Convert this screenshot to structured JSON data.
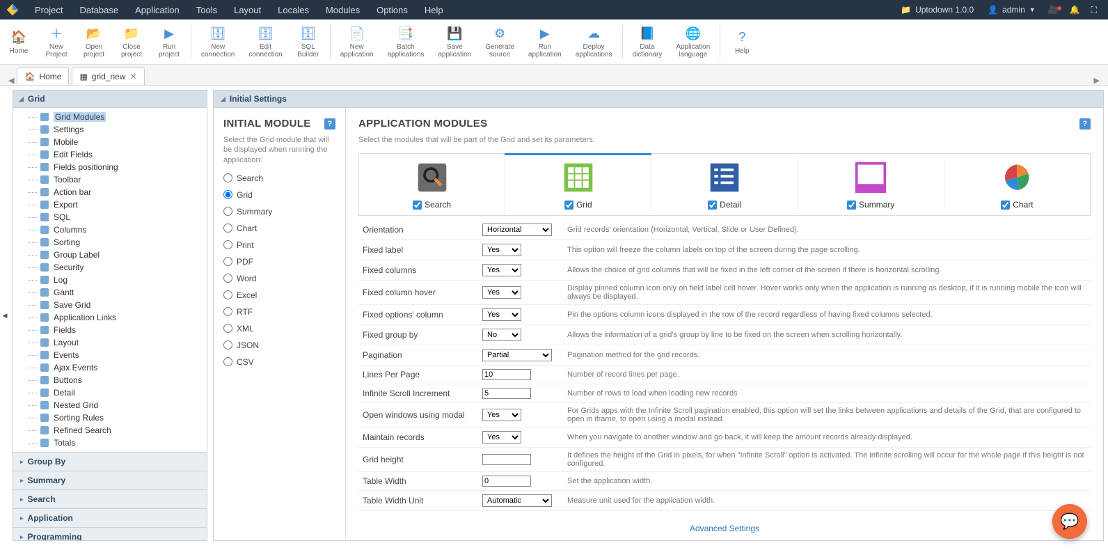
{
  "menubar": {
    "items": [
      "Project",
      "Database",
      "Application",
      "Tools",
      "Layout",
      "Locales",
      "Modules",
      "Options",
      "Help"
    ],
    "project_label": "Uptodown 1.0.0",
    "user_label": "admin"
  },
  "toolbar": {
    "groups": [
      [
        {
          "icon": "🏠",
          "label": "Home"
        },
        {
          "icon": "＋",
          "label": "New\nProject"
        },
        {
          "icon": "📂",
          "label": "Open\nproject"
        },
        {
          "icon": "📁",
          "label": "Close\nproject"
        },
        {
          "icon": "▶",
          "label": "Run\nproject"
        }
      ],
      [
        {
          "icon": "🗄",
          "label": "New\nconnection"
        },
        {
          "icon": "🗄",
          "label": "Edit\nconnection"
        },
        {
          "icon": "🗄",
          "label": "SQL\nBuilder"
        }
      ],
      [
        {
          "icon": "📄",
          "label": "New\napplication"
        },
        {
          "icon": "📑",
          "label": "Batch\napplications"
        },
        {
          "icon": "💾",
          "label": "Save\napplication"
        },
        {
          "icon": "⚙",
          "label": "Generate\nsource"
        },
        {
          "icon": "▶",
          "label": "Run\napplication"
        },
        {
          "icon": "☁",
          "label": "Deploy\napplications"
        }
      ],
      [
        {
          "icon": "📘",
          "label": "Data\ndictionary"
        },
        {
          "icon": "🌐",
          "label": "Application\nlanguage"
        }
      ],
      [
        {
          "icon": "?",
          "label": "Help"
        }
      ]
    ]
  },
  "tabs": [
    {
      "icon": "🏠",
      "label": "Home",
      "closable": false
    },
    {
      "icon": "▦",
      "label": "grid_new",
      "closable": true
    }
  ],
  "sidebar": {
    "title": "Grid",
    "tree": [
      {
        "label": "Grid Modules",
        "selected": true
      },
      {
        "label": "Settings"
      },
      {
        "label": "Mobile"
      },
      {
        "label": "Edit Fields"
      },
      {
        "label": "Fields positioning"
      },
      {
        "label": "Toolbar"
      },
      {
        "label": "Action bar"
      },
      {
        "label": "Export"
      },
      {
        "label": "SQL"
      },
      {
        "label": "Columns"
      },
      {
        "label": "Sorting"
      },
      {
        "label": "Group Label"
      },
      {
        "label": "Security"
      },
      {
        "label": "Log"
      },
      {
        "label": "Gantt"
      },
      {
        "label": "Save Grid"
      },
      {
        "label": "Application Links"
      },
      {
        "label": "Fields"
      },
      {
        "label": "Layout"
      },
      {
        "label": "Events"
      },
      {
        "label": "Ajax Events"
      },
      {
        "label": "Buttons"
      },
      {
        "label": "Detail"
      },
      {
        "label": "Nested Grid"
      },
      {
        "label": "Sorting Rules"
      },
      {
        "label": "Refined Search"
      },
      {
        "label": "Totals"
      }
    ],
    "accordions": [
      "Group By",
      "Summary",
      "Search",
      "Application",
      "Programming"
    ]
  },
  "content": {
    "title": "Initial Settings",
    "init_title": "INITIAL MODULE",
    "init_sub": "Select the Grid module that will be displayed when running the application:",
    "radios": [
      "Search",
      "Grid",
      "Summary",
      "Chart",
      "Print",
      "PDF",
      "Word",
      "Excel",
      "RTF",
      "XML",
      "JSON",
      "CSV"
    ],
    "radio_selected": "Grid",
    "app_title": "APPLICATION MODULES",
    "app_sub": "Select the modules that will be part of the Grid and set its parameters:",
    "modules": [
      {
        "label": "Search",
        "color": "#6b6b6b",
        "active": false
      },
      {
        "label": "Grid",
        "color": "#7cc24a",
        "active": true
      },
      {
        "label": "Detail",
        "color": "#2f5fa5",
        "active": false
      },
      {
        "label": "Summary",
        "color": "#c24aca",
        "active": false
      },
      {
        "label": "Chart",
        "color": "#e8893a",
        "active": false
      }
    ],
    "rows": [
      {
        "k": "Orientation",
        "type": "select-wide",
        "value": "Horizontal",
        "d": "Grid records' orientation (Horizontal, Vertical, Slide or User Defined)."
      },
      {
        "k": "Fixed label",
        "type": "select",
        "value": "Yes",
        "d": "This option will freeze the column labels on top of the screen during the page scrolling."
      },
      {
        "k": "Fixed columns",
        "type": "select",
        "value": "Yes",
        "d": "Allows the choice of grid columns that will be fixed in the left corner of the screen if there is horizontal scrolling."
      },
      {
        "k": "Fixed column hover",
        "type": "select",
        "value": "Yes",
        "d": "Display pinned column icon only on field label cell hover. Hover works only when the application is running as desktop, if it is running mobile the icon will always be displayed."
      },
      {
        "k": "Fixed options' column",
        "type": "select",
        "value": "Yes",
        "d": "Pin the options column icons displayed in the row of the record regardless of having fixed columns selected."
      },
      {
        "k": "Fixed group by",
        "type": "select",
        "value": "No",
        "d": "Allows the information of a grid's group by line to be fixed on the screen when scrolling horizontally."
      },
      {
        "k": "Pagination",
        "type": "select-wide",
        "value": "Partial",
        "d": "Pagination method for the grid records."
      },
      {
        "k": "Lines Per Page",
        "type": "text",
        "value": "10",
        "d": "Number of record lines per page."
      },
      {
        "k": "Infinite Scroll Increment",
        "type": "text",
        "value": "5",
        "d": "Number of rows to load when loading new records"
      },
      {
        "k": "Open windows using modal",
        "type": "select",
        "value": "Yes",
        "d": "For Grids apps with the Infinite Scroll pagination enabled, this option will set the links between applications and details of the Grid, that are configured to open in iframe, to open using a modal instead."
      },
      {
        "k": "Maintain records",
        "type": "select",
        "value": "Yes",
        "d": "When you navigate to another window and go back, it will keep the amount records already displayed."
      },
      {
        "k": "Grid height",
        "type": "text",
        "value": "",
        "d": "It defines the height of the Grid in pixels, for when \"Infinite Scroll\" option is activated. The infinite scrolling will occur for the whole page if this height is not configured."
      },
      {
        "k": "Table Width",
        "type": "text",
        "value": "0",
        "d": "Set the application width."
      },
      {
        "k": "Table Width Unit",
        "type": "select-wide",
        "value": "Automatic",
        "d": "Measure unit used for the application width."
      }
    ],
    "advanced_label": "Advanced Settings"
  }
}
